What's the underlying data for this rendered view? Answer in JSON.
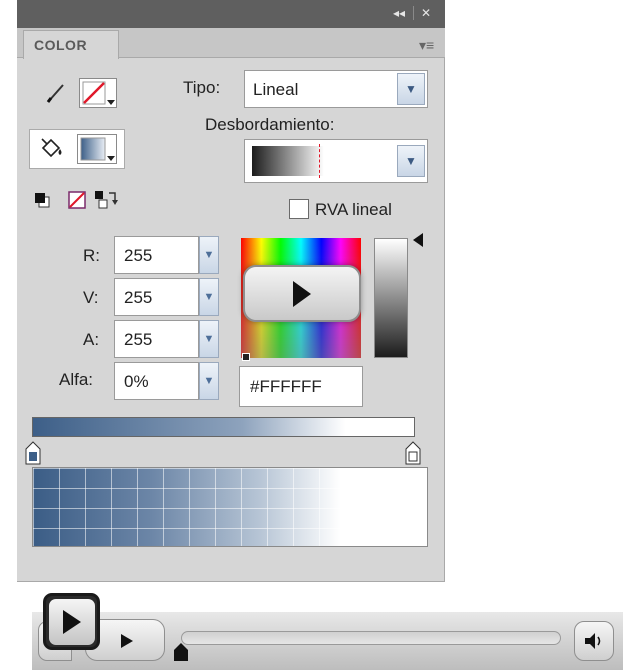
{
  "panel": {
    "tab_label": "COLOR",
    "titlebar_collapse_label": "◂◂",
    "titlebar_close_label": "✕",
    "menu_icon": "panel-menu-icon"
  },
  "tools": {
    "stroke_icon": "pencil-icon",
    "fill_icon": "paint-bucket-icon",
    "small_icons": [
      "black-white-icon",
      "no-color-icon",
      "swap-colors-icon"
    ]
  },
  "fill": {
    "tipo_label": "Tipo:",
    "tipo_value": "Lineal",
    "overflow_label": "Desbordamiento:",
    "linear_rgb_label": "RVA lineal",
    "linear_rgb_checked": false
  },
  "channels": [
    {
      "label": "R:",
      "value": "255"
    },
    {
      "label": "V:",
      "value": "255"
    },
    {
      "label": "A:",
      "value": "255"
    },
    {
      "label": "Alfa:",
      "value": "0%"
    }
  ],
  "hex": "#FFFFFF",
  "colors": {
    "gradient_start": "#3d5f88",
    "gradient_end": "#ffffff",
    "panel_bg": "#d6d6d6",
    "titlebar": "#5f5f5f"
  },
  "player": {
    "play_icon": "play-icon",
    "volume_icon": "speaker-icon",
    "progress": 0
  }
}
